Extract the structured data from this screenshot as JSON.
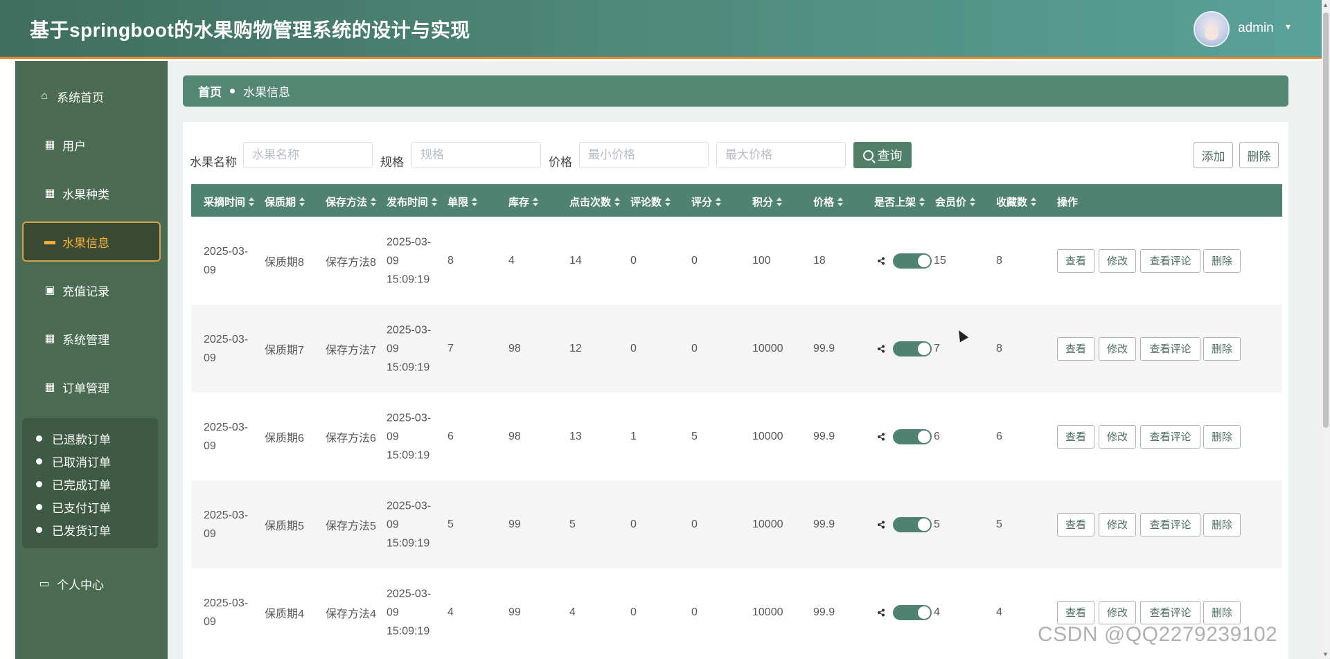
{
  "header": {
    "title": "基于springboot的水果购物管理系统的设计与实现",
    "user_name": "admin"
  },
  "sidebar": {
    "items": [
      {
        "label": "系统首页",
        "icon": "home-icon"
      },
      {
        "label": "用户",
        "icon": "grid-icon"
      },
      {
        "label": "水果种类",
        "icon": "grid-icon"
      },
      {
        "label": "水果信息",
        "icon": "briefcase-icon",
        "active": true
      },
      {
        "label": "充值记录",
        "icon": "chart-icon"
      },
      {
        "label": "系统管理",
        "icon": "grid-icon"
      },
      {
        "label": "订单管理",
        "icon": "grid-icon"
      }
    ],
    "submenu": [
      "已退款订单",
      "已取消订单",
      "已完成订单",
      "已支付订单",
      "已发货订单"
    ],
    "personal": "个人中心"
  },
  "breadcrumb": {
    "home": "首页",
    "current": "水果信息"
  },
  "search": {
    "name_label": "水果名称",
    "name_placeholder": "水果名称",
    "spec_label": "规格",
    "spec_placeholder": "规格",
    "price_label": "价格",
    "min_placeholder": "最小价格",
    "max_placeholder": "最大价格",
    "query_label": "查询",
    "add_label": "添加",
    "delete_label": "删除"
  },
  "table": {
    "columns": [
      "采摘时间",
      "保质期",
      "保存方法",
      "发布时间",
      "单限",
      "库存",
      "点击次数",
      "评论数",
      "评分",
      "积分",
      "价格",
      "是否上架",
      "会员价",
      "收藏数",
      "操作"
    ],
    "actions": [
      "查看",
      "修改",
      "查看评论",
      "删除"
    ],
    "rows": [
      {
        "pick": "2025-03-09",
        "shelf": "保质期8",
        "method": "保存方法8",
        "pub": "2025-03-09 15:09:19",
        "limit": "8",
        "stock": "4",
        "clicks": "14",
        "comments": "0",
        "score": "0",
        "points": "100",
        "price": "18",
        "member": "15",
        "favs": "8"
      },
      {
        "pick": "2025-03-09",
        "shelf": "保质期7",
        "method": "保存方法7",
        "pub": "2025-03-09 15:09:19",
        "limit": "7",
        "stock": "98",
        "clicks": "12",
        "comments": "0",
        "score": "0",
        "points": "10000",
        "price": "99.9",
        "member": "7",
        "favs": "8"
      },
      {
        "pick": "2025-03-09",
        "shelf": "保质期6",
        "method": "保存方法6",
        "pub": "2025-03-09 15:09:19",
        "limit": "6",
        "stock": "98",
        "clicks": "13",
        "comments": "1",
        "score": "5",
        "points": "10000",
        "price": "99.9",
        "member": "6",
        "favs": "6"
      },
      {
        "pick": "2025-03-09",
        "shelf": "保质期5",
        "method": "保存方法5",
        "pub": "2025-03-09 15:09:19",
        "limit": "5",
        "stock": "99",
        "clicks": "5",
        "comments": "0",
        "score": "0",
        "points": "10000",
        "price": "99.9",
        "member": "5",
        "favs": "5"
      },
      {
        "pick": "2025-03-09",
        "shelf": "保质期4",
        "method": "保存方法4",
        "pub": "2025-03-09 15:09:19",
        "limit": "4",
        "stock": "99",
        "clicks": "4",
        "comments": "0",
        "score": "0",
        "points": "10000",
        "price": "99.9",
        "member": "4",
        "favs": "4"
      }
    ]
  },
  "watermark": "CSDN @QQ2279239102",
  "colors": {
    "header": "#4f8a7a",
    "accent": "#e58a2c",
    "sidebar": "#4a6b52",
    "table_head": "#4f8270"
  }
}
